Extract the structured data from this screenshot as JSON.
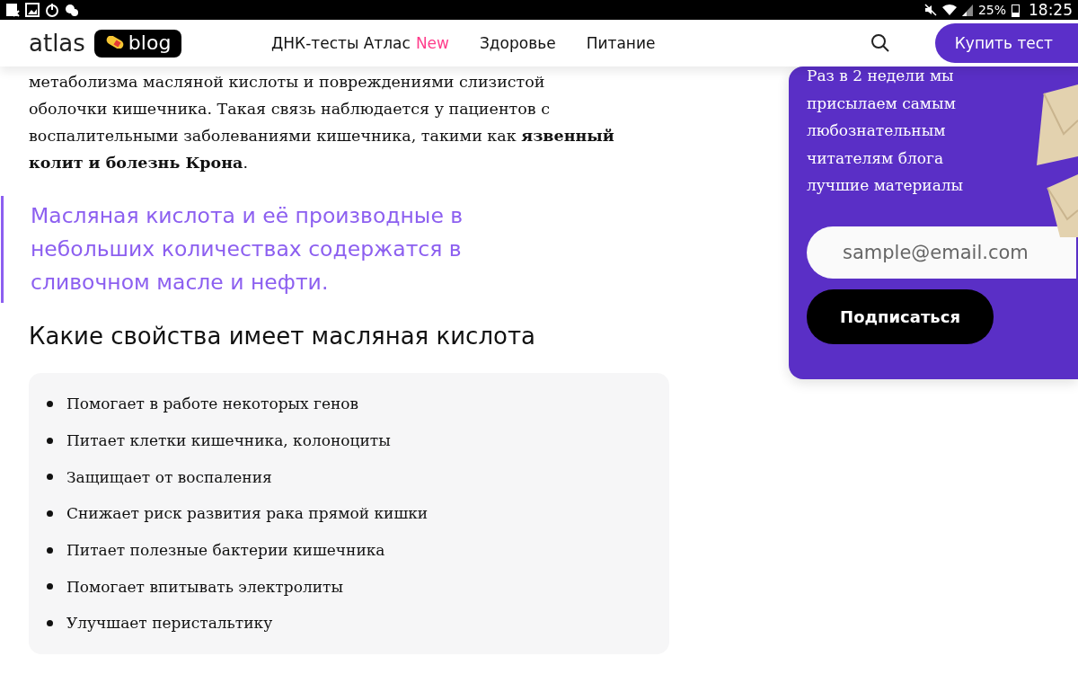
{
  "status_bar": {
    "battery": "25%",
    "time": "18:25"
  },
  "header": {
    "logo": "atlas",
    "logo_badge": "blog",
    "nav": [
      {
        "label": "ДНК-тесты Атлас",
        "badge": "New"
      },
      {
        "label": "Здоровье"
      },
      {
        "label": "Питание"
      }
    ],
    "cta": "Купить тест"
  },
  "article": {
    "paragraph": "метаболизма масляной кислоты и повреждениями слизистой оболочки кишечника. Такая связь наблюдается у пациентов с воспалительными заболеваниями кишечника, такими как **язвенный колит и болезнь Крона**.",
    "quote": "Масляная кислота и её производные в небольших количествах содержатся в сливочном масле и нефти.",
    "heading": "Какие свойства имеет масляная кислота",
    "list": [
      "Помогает в работе некоторых генов",
      "Питает клетки кишечника, колоноциты",
      "Защищает от воспаления",
      "Снижает риск развития рака прямой кишки",
      "Питает полезные бактерии кишечника",
      "Помогает впитывать электролиты",
      "Улучшает перистальтику"
    ]
  },
  "subscribe": {
    "text": "Раз в 2 недели мы присылаем самым любознательным читателям блога лучшие материалы",
    "placeholder": "sample@email.com",
    "button": "Подписаться"
  }
}
